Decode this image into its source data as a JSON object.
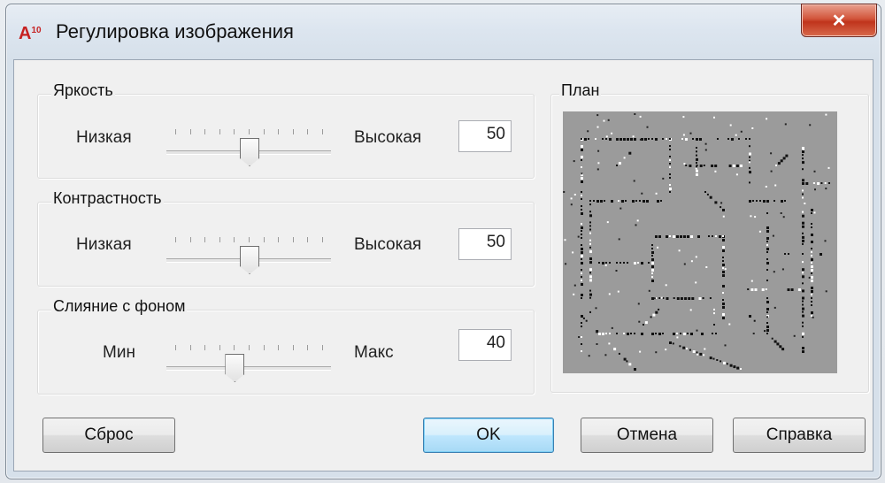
{
  "window": {
    "title": "Регулировка изображения",
    "app_icon_text": "A",
    "app_icon_sub": "10",
    "close_glyph": "✕"
  },
  "brightness": {
    "group_label": "Яркость",
    "low_label": "Низкая",
    "high_label": "Высокая",
    "value": "50",
    "slider_fraction": 0.5
  },
  "contrast": {
    "group_label": "Контрастность",
    "low_label": "Низкая",
    "high_label": "Высокая",
    "value": "50",
    "slider_fraction": 0.5
  },
  "fade": {
    "group_label": "Слияние с фоном",
    "low_label": "Мин",
    "high_label": "Макс",
    "value": "40",
    "slider_fraction": 0.4
  },
  "preview": {
    "group_label": "План"
  },
  "buttons": {
    "reset": "Сброс",
    "ok": "OK",
    "cancel": "Отмена",
    "help": "Справка"
  },
  "colors": {
    "preview_bg": "#9b9b9b",
    "close_red": "#c0341c"
  }
}
